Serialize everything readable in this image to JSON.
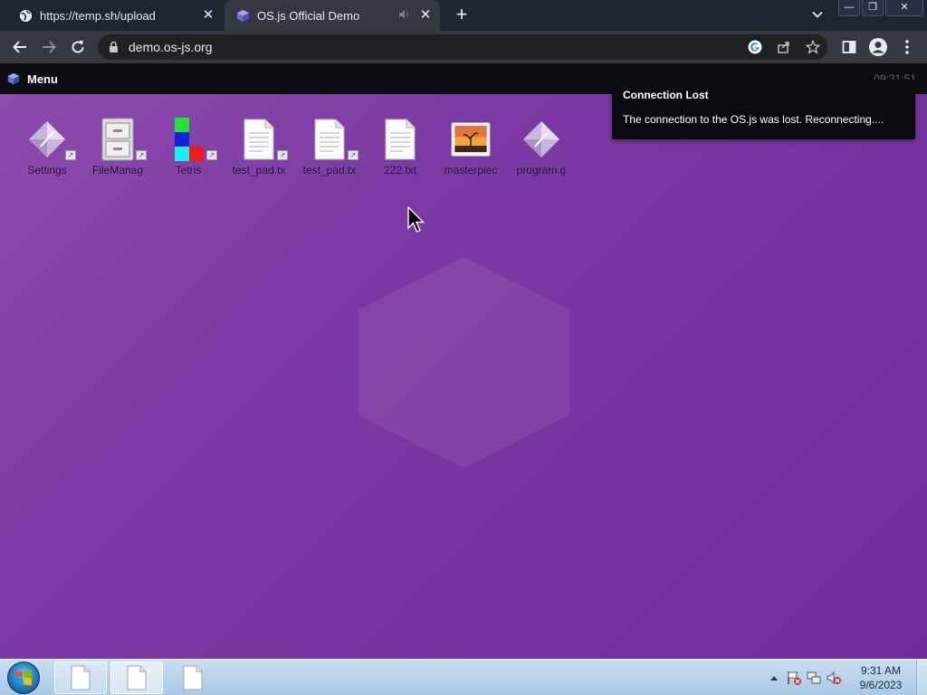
{
  "browser": {
    "tabs": [
      {
        "title": "https://temp.sh/upload",
        "close": "✕"
      },
      {
        "title": "OS.js Official Demo",
        "close": "✕"
      }
    ],
    "new_tab": "+",
    "window_buttons": {
      "minimize": "—",
      "restore": "❐",
      "close": "✕"
    },
    "url": "demo.os-js.org"
  },
  "osjs": {
    "menu_label": "Menu",
    "panel_clock": "09:31:51",
    "desktop_icons": [
      {
        "label": "Settings",
        "icon": "settings-icon"
      },
      {
        "label": "FileManag",
        "icon": "file-manager-icon"
      },
      {
        "label": "Tetris",
        "icon": "tetris-icon"
      },
      {
        "label": "test_pad.tx",
        "icon": "text-file-icon"
      },
      {
        "label": "test_pad.tx",
        "icon": "text-file-icon"
      },
      {
        "label": "222.txt",
        "icon": "text-file-icon"
      },
      {
        "label": "masterpiec",
        "icon": "image-file-icon"
      },
      {
        "label": "program.g",
        "icon": "program-icon"
      }
    ],
    "notification": {
      "title": "Connection Lost",
      "message": "The connection to the OS.js was lost. Reconnecting...."
    }
  },
  "taskbar": {
    "clock_time": "9:31 AM",
    "clock_date": "9/6/2023"
  },
  "colors": {
    "desktop_bg": "#7b3aa3",
    "panel_bg": "#0d0d12",
    "notification_bg": "#0c0c10"
  }
}
